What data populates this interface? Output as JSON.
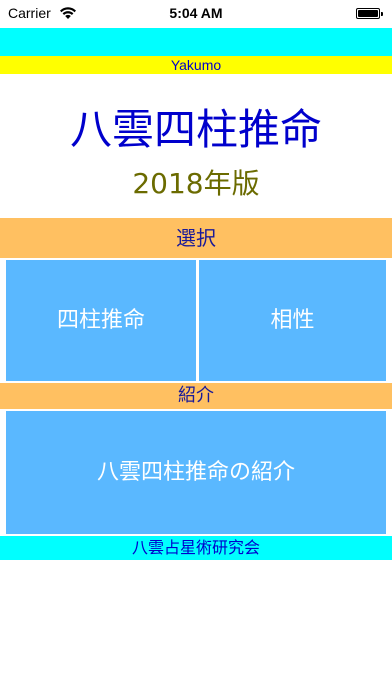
{
  "status_bar": {
    "carrier": "Carrier",
    "time": "5:04 AM",
    "wifi_icon": "wifi-icon",
    "battery_icon": "battery-icon",
    "battery_level": 1.0
  },
  "header": {
    "brand": "Yakumo"
  },
  "title": {
    "app_name": "八雲四柱推命",
    "edition": "2018年版"
  },
  "sections": {
    "select_label": "選択",
    "intro_label": "紹介"
  },
  "tiles": {
    "shichu": "四柱推命",
    "aisho": "相性",
    "intro": "八雲四柱推命の紹介"
  },
  "footer": {
    "org": "八雲占星術研究会"
  },
  "colors": {
    "cyan": "#00ffff",
    "yellow": "#ffff00",
    "orange": "#ffc061",
    "tile_blue": "#5ab8ff",
    "title_blue": "#0000cc",
    "edition_olive": "#6b6b00"
  }
}
